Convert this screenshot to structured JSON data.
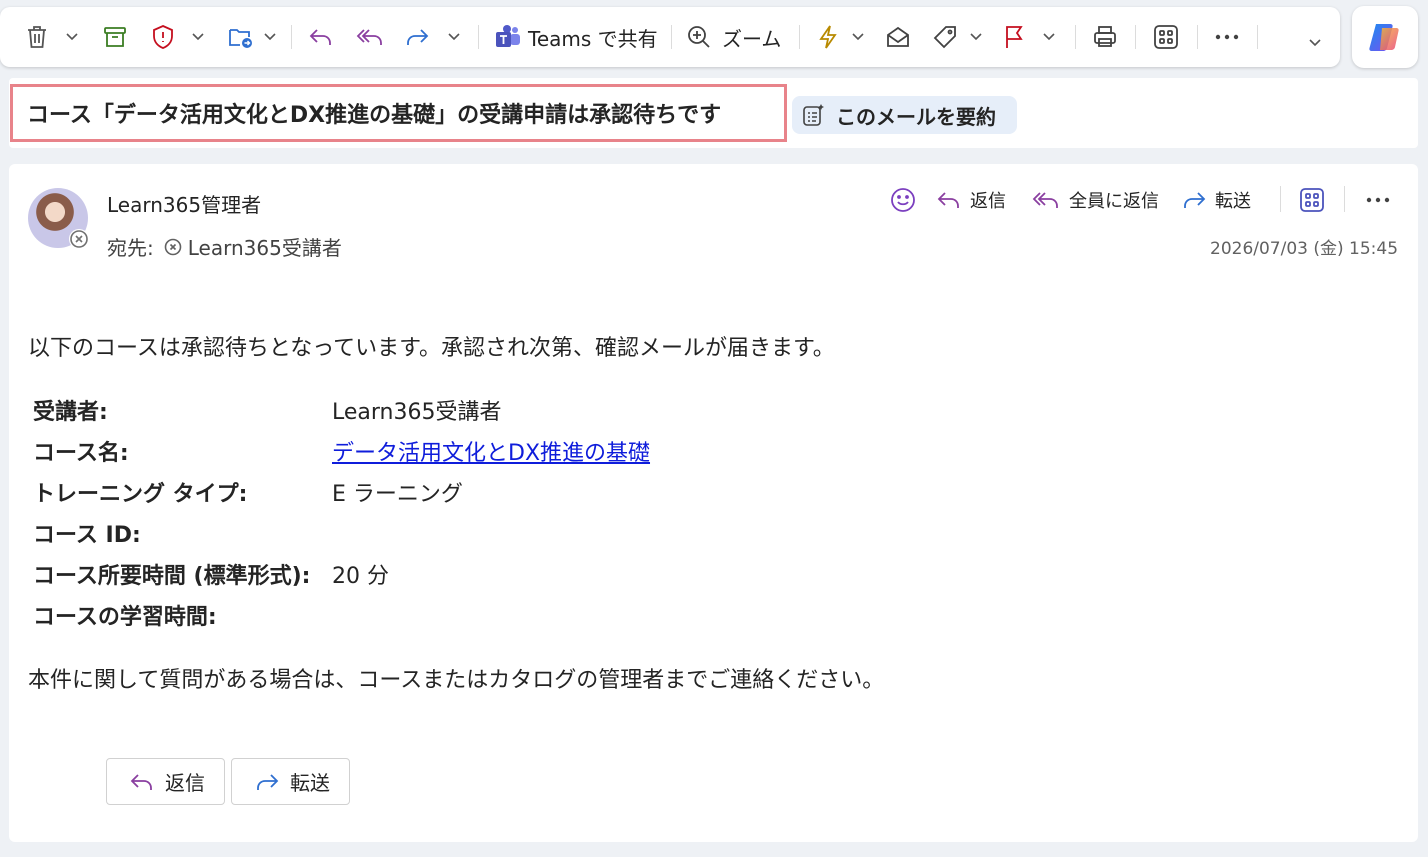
{
  "toolbar": {
    "teams_label": "Teams で共有",
    "zoom_label": "ズーム"
  },
  "subject": "コース「データ活用文化とDX推進の基礎」の受講申請は承認待ちです",
  "summarize_label": "このメールを要約",
  "sender": "Learn365管理者",
  "to_prefix": "宛先:",
  "recipient": "Learn365受講者",
  "actions": {
    "reply": "返信",
    "reply_all": "全員に返信",
    "forward": "転送"
  },
  "date": "2026/07/03 (金) 15:45",
  "body": {
    "intro": "以下のコースは承認待ちとなっています。承認され次第、確認メールが届きます。",
    "fields": [
      {
        "label": "受講者:",
        "value": "Learn365受講者"
      },
      {
        "label": "コース名:",
        "value": "データ活用文化とDX推進の基礎"
      },
      {
        "label": "トレーニング タイプ:",
        "value": "E ラーニング"
      },
      {
        "label": "コース ID:",
        "value": ""
      },
      {
        "label": "コース所要時間 (標準形式):",
        "value": "20 分"
      },
      {
        "label": "コースの学習時間:",
        "value": ""
      }
    ],
    "footer": "本件に関して質問がある場合は、コースまたはカタログの管理者までご連絡ください。"
  },
  "bottom_buttons": {
    "reply": "返信",
    "forward": "転送"
  },
  "colors": {
    "accent_purple": "#7b3fbf",
    "reply_arrow": "#8a3fa0",
    "forward_arrow": "#2f6fd0",
    "flag_red": "#c50f1f",
    "link_blue": "#0f1ddb",
    "highlight_border": "#e8838a"
  }
}
